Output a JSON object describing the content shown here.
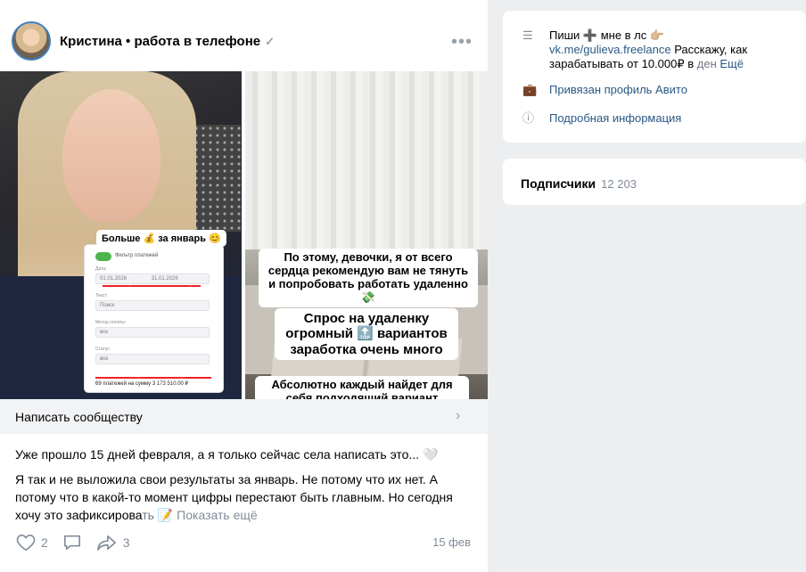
{
  "post": {
    "author": "Кристина • работа в телефоне",
    "more": "•••",
    "gallery": {
      "left_sticker": "Больше 💰 за январь 😊",
      "card_title": "Фильтр платежей",
      "card_date_label": "Дата:",
      "card_date_from": "01.01.2026",
      "card_date_to": "31.01.2026",
      "card_text_label": "Текст:",
      "card_text_placeholder": "Поиск",
      "card_method_label": "Метод оплаты:",
      "card_method_value": "все",
      "card_status_label": "Статус:",
      "card_status_value": "все",
      "card_footer": "69 платежей на сумму 3 173 510.00 ₽",
      "caption1": "По этому, девочки, я от всего сердца рекомендую вам не тянуть и попробовать работать удаленно 💸",
      "caption2": "Спрос на удаленку огромный 🔝 вариантов заработка очень много",
      "caption3": "Абсолютно каждый найдет для себя подходящий вариант"
    },
    "write_community": "Написать сообществу",
    "text_p1": "Уже прошло 15 дней февраля, а я только сейчас села написать это... 🤍",
    "text_p2_main": "Я так и не выложила свои результаты за январь. Не потому что их нет. А потому что в какой-то момент цифры перестают быть главным. Но сегодня хочу это зафиксирова",
    "text_p2_fade": "ть 📝",
    "show_more": "Показать ещё",
    "likes": "2",
    "shares": "3",
    "date": "15 фев"
  },
  "sidebar": {
    "info": {
      "text_line": "Пиши ➕ мне в лс 👉🏼",
      "link": "vk.me/gulieva.freelance",
      "text_rest": " Расскажу, как зарабатывать от 10.000₽ в ",
      "text_fade": "ден",
      "more": "Ещё",
      "avito": "Привязан профиль Авито",
      "details": "Подробная информация"
    },
    "subscribers": {
      "title": "Подписчики",
      "count": "12 203"
    }
  },
  "icons": {
    "like": "heart-icon",
    "comment": "comment-icon",
    "share": "share-icon",
    "menu": "lines-icon",
    "briefcase": "briefcase-icon",
    "info": "info-icon"
  }
}
